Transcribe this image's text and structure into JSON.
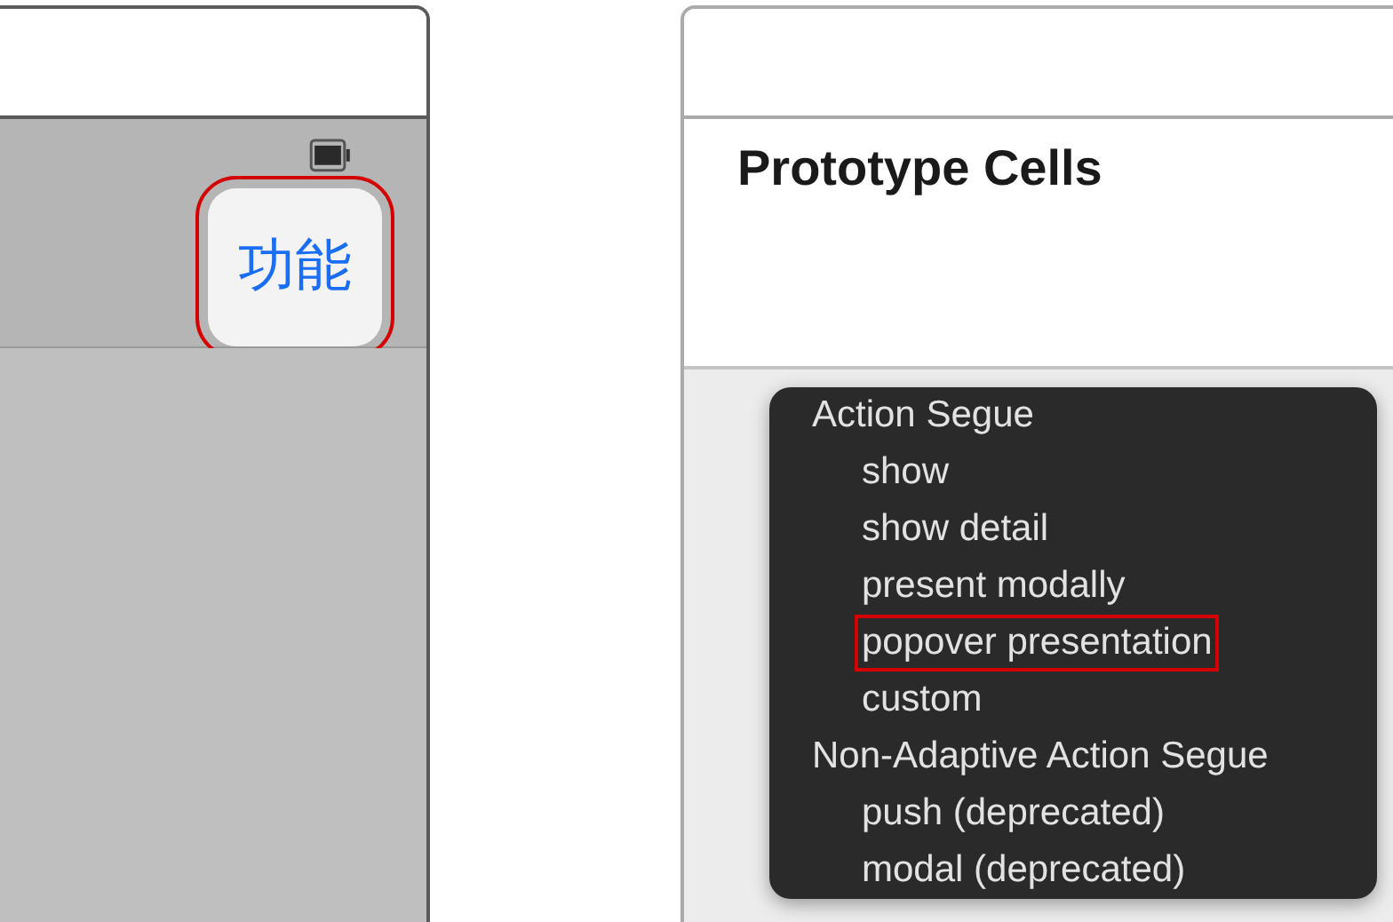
{
  "left_scene": {
    "button": {
      "label": "功能",
      "highlighted": true
    }
  },
  "right_scene": {
    "section_title": "Prototype Cells",
    "menu": {
      "items": [
        {
          "kind": "header",
          "label": "Action Segue",
          "highlighted": false
        },
        {
          "kind": "option",
          "label": "show",
          "highlighted": false
        },
        {
          "kind": "option",
          "label": "show detail",
          "highlighted": false
        },
        {
          "kind": "option",
          "label": "present modally",
          "highlighted": false
        },
        {
          "kind": "option",
          "label": "popover presentation",
          "highlighted": true
        },
        {
          "kind": "option",
          "label": "custom",
          "highlighted": false
        },
        {
          "kind": "header",
          "label": "Non-Adaptive Action Segue",
          "highlighted": false
        },
        {
          "kind": "option",
          "label": "push (deprecated)",
          "highlighted": false
        },
        {
          "kind": "option",
          "label": "modal (deprecated)",
          "highlighted": false
        }
      ]
    }
  }
}
